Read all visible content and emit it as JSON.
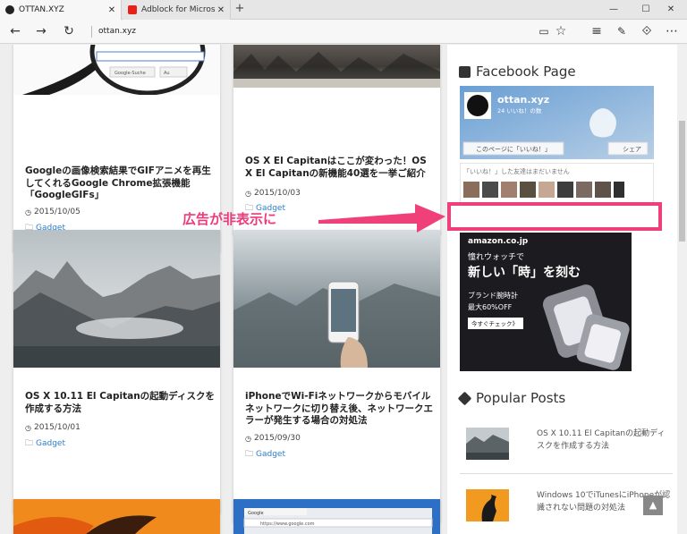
{
  "browser": {
    "tabs": [
      {
        "title": "OTTAN.XYZ",
        "active": true
      },
      {
        "title": "Adblock for Microsoft Edge",
        "active": false
      }
    ],
    "new_tab_label": "+",
    "close_glyph": "✕",
    "window": {
      "minimize": "—",
      "maximize": "☐",
      "close": "✕"
    },
    "address": "ottan.xyz",
    "icons": {
      "back": "←",
      "forward": "→",
      "refresh": "↻",
      "reading": "▭",
      "favorite": "☆",
      "hub": "≡",
      "note": "✎",
      "share": "⟐",
      "more": "⋯"
    }
  },
  "cards": [
    {
      "title": "Googleの画像検索結果でGIFアニメを再生してくれるGoogle Chrome拡張機能「GoogleGIFs」",
      "date": "2015/10/05",
      "category": "Gadget",
      "thumb_labels": [
        "Google-Suche",
        "Au"
      ]
    },
    {
      "title": "OS X El Capitanはここが変わった！OS X El Capitanの新機能40選を一挙ご紹介",
      "date": "2015/10/03",
      "category": "Gadget"
    },
    {
      "title": "OS X 10.11 El Capitanの起動ディスクを作成する方法",
      "date": "2015/10/01",
      "category": "Gadget"
    },
    {
      "title": "iPhoneでWi-Fiネットワークからモバイルネットワークに切り替え後、ネットワークエラーが発生する場合の対処法",
      "date": "2015/09/30",
      "category": "Gadget"
    },
    {
      "thumb_labels": [
        "Google",
        "https://www.google.com"
      ]
    }
  ],
  "sidebar": {
    "facebook": {
      "heading": "Facebook Page",
      "page_name": "ottan.xyz",
      "likes": "24 いいね！の数",
      "like_button": "このページに「いいね！」",
      "share_button": "シェア",
      "friends_text": "「いいね！」した友達はまだいません"
    },
    "ad": {
      "brand": "amazon.co.jp",
      "line1": "憧れウォッチで",
      "line2": "新しい「時」を刻む",
      "line3": "ブランド腕時計",
      "line4": "最大60%OFF",
      "cta": "今すぐチェック》"
    },
    "popular": {
      "heading": "Popular Posts",
      "posts": [
        {
          "title": "OS X 10.11 El Capitanの起動ディスクを作成する方法"
        },
        {
          "title": "Windows 10でiTunesにiPhoneが認識されない問題の対処法"
        }
      ]
    }
  },
  "annotation": {
    "label": "広告が非表示に",
    "color": "#f0407a"
  },
  "scroll_top": "▲"
}
